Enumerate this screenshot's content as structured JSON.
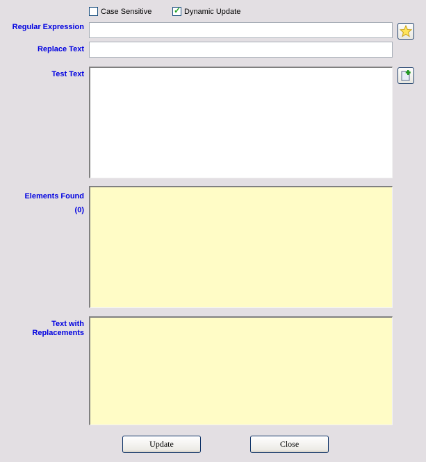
{
  "options": {
    "case_sensitive": {
      "label": "Case Sensitive",
      "checked": false
    },
    "dynamic_update": {
      "label": "Dynamic Update",
      "checked": true
    }
  },
  "fields": {
    "regex": {
      "label": "Regular Expression",
      "value": ""
    },
    "replace": {
      "label": "Replace Text",
      "value": ""
    },
    "test_text": {
      "label": "Test Text",
      "value": ""
    },
    "elements_found": {
      "label": "Elements Found",
      "count": "(0)",
      "value": ""
    },
    "text_with_replacements": {
      "label_line1": "Text with",
      "label_line2": "Replacements",
      "value": ""
    }
  },
  "icons": {
    "favorites": "star-icon",
    "new_document": "new-document-icon"
  },
  "buttons": {
    "update": "Update",
    "close": "Close"
  },
  "colors": {
    "label": "#0000e0",
    "background": "#e3dfe3",
    "result_area": "#fffcc6",
    "check": "#21a121"
  }
}
